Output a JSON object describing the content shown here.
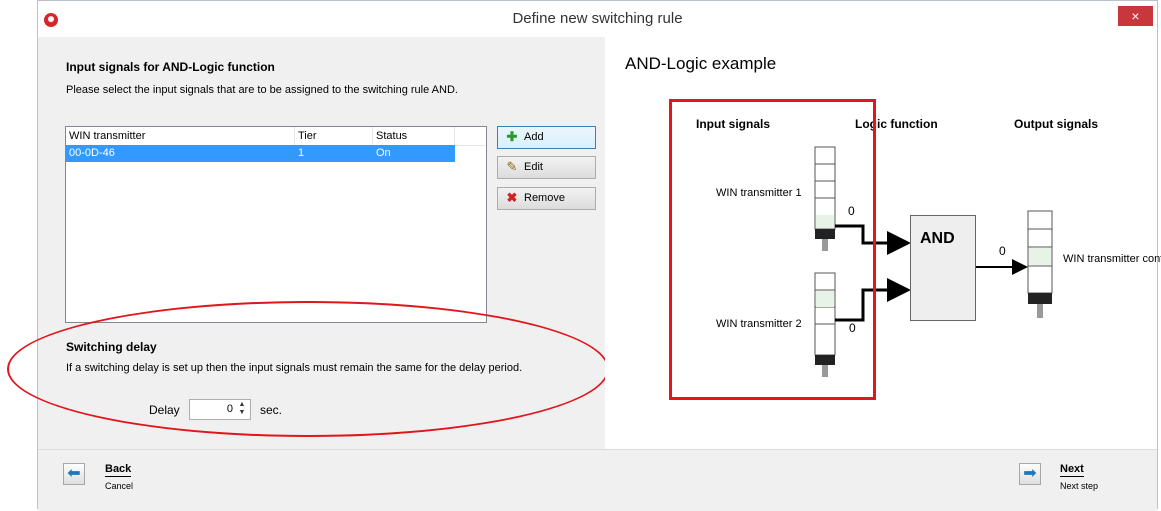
{
  "window": {
    "title": "Define new switching rule",
    "close_glyph": "×",
    "app_icon": "app-logo-icon"
  },
  "input_section": {
    "heading": "Input signals for AND-Logic function",
    "description": "Please select the input signals that are to be assigned to the switching rule AND."
  },
  "table": {
    "columns": [
      "WIN transmitter",
      "Tier",
      "Status"
    ],
    "rows": [
      {
        "transmitter": "00-0D-46",
        "tier": "1",
        "status": "On",
        "selected": true
      }
    ]
  },
  "buttons": {
    "add": "Add",
    "edit": "Edit",
    "remove": "Remove"
  },
  "delay_section": {
    "heading": "Switching delay",
    "description": "If a switching delay is set up then the input signals must remain the same for the delay period.",
    "delay_label": "Delay",
    "delay_value": "0",
    "unit": "sec."
  },
  "example": {
    "title": "AND-Logic example",
    "col_input": "Input signals",
    "col_logic": "Logic function",
    "col_output": "Output signals",
    "transmitter1": "WIN transmitter 1",
    "transmitter2": "WIN transmitter 2",
    "input1_value": "0",
    "input2_value": "0",
    "logic_label": "AND",
    "output_value": "0",
    "output_label": "WIN transmitter control"
  },
  "nav": {
    "back": "Back",
    "back_sub": "Cancel",
    "next": "Next",
    "next_sub": "Next step"
  },
  "colors": {
    "highlight_red": "#e3141b",
    "selection_blue": "#3399ff",
    "close_red": "#c7373c"
  }
}
